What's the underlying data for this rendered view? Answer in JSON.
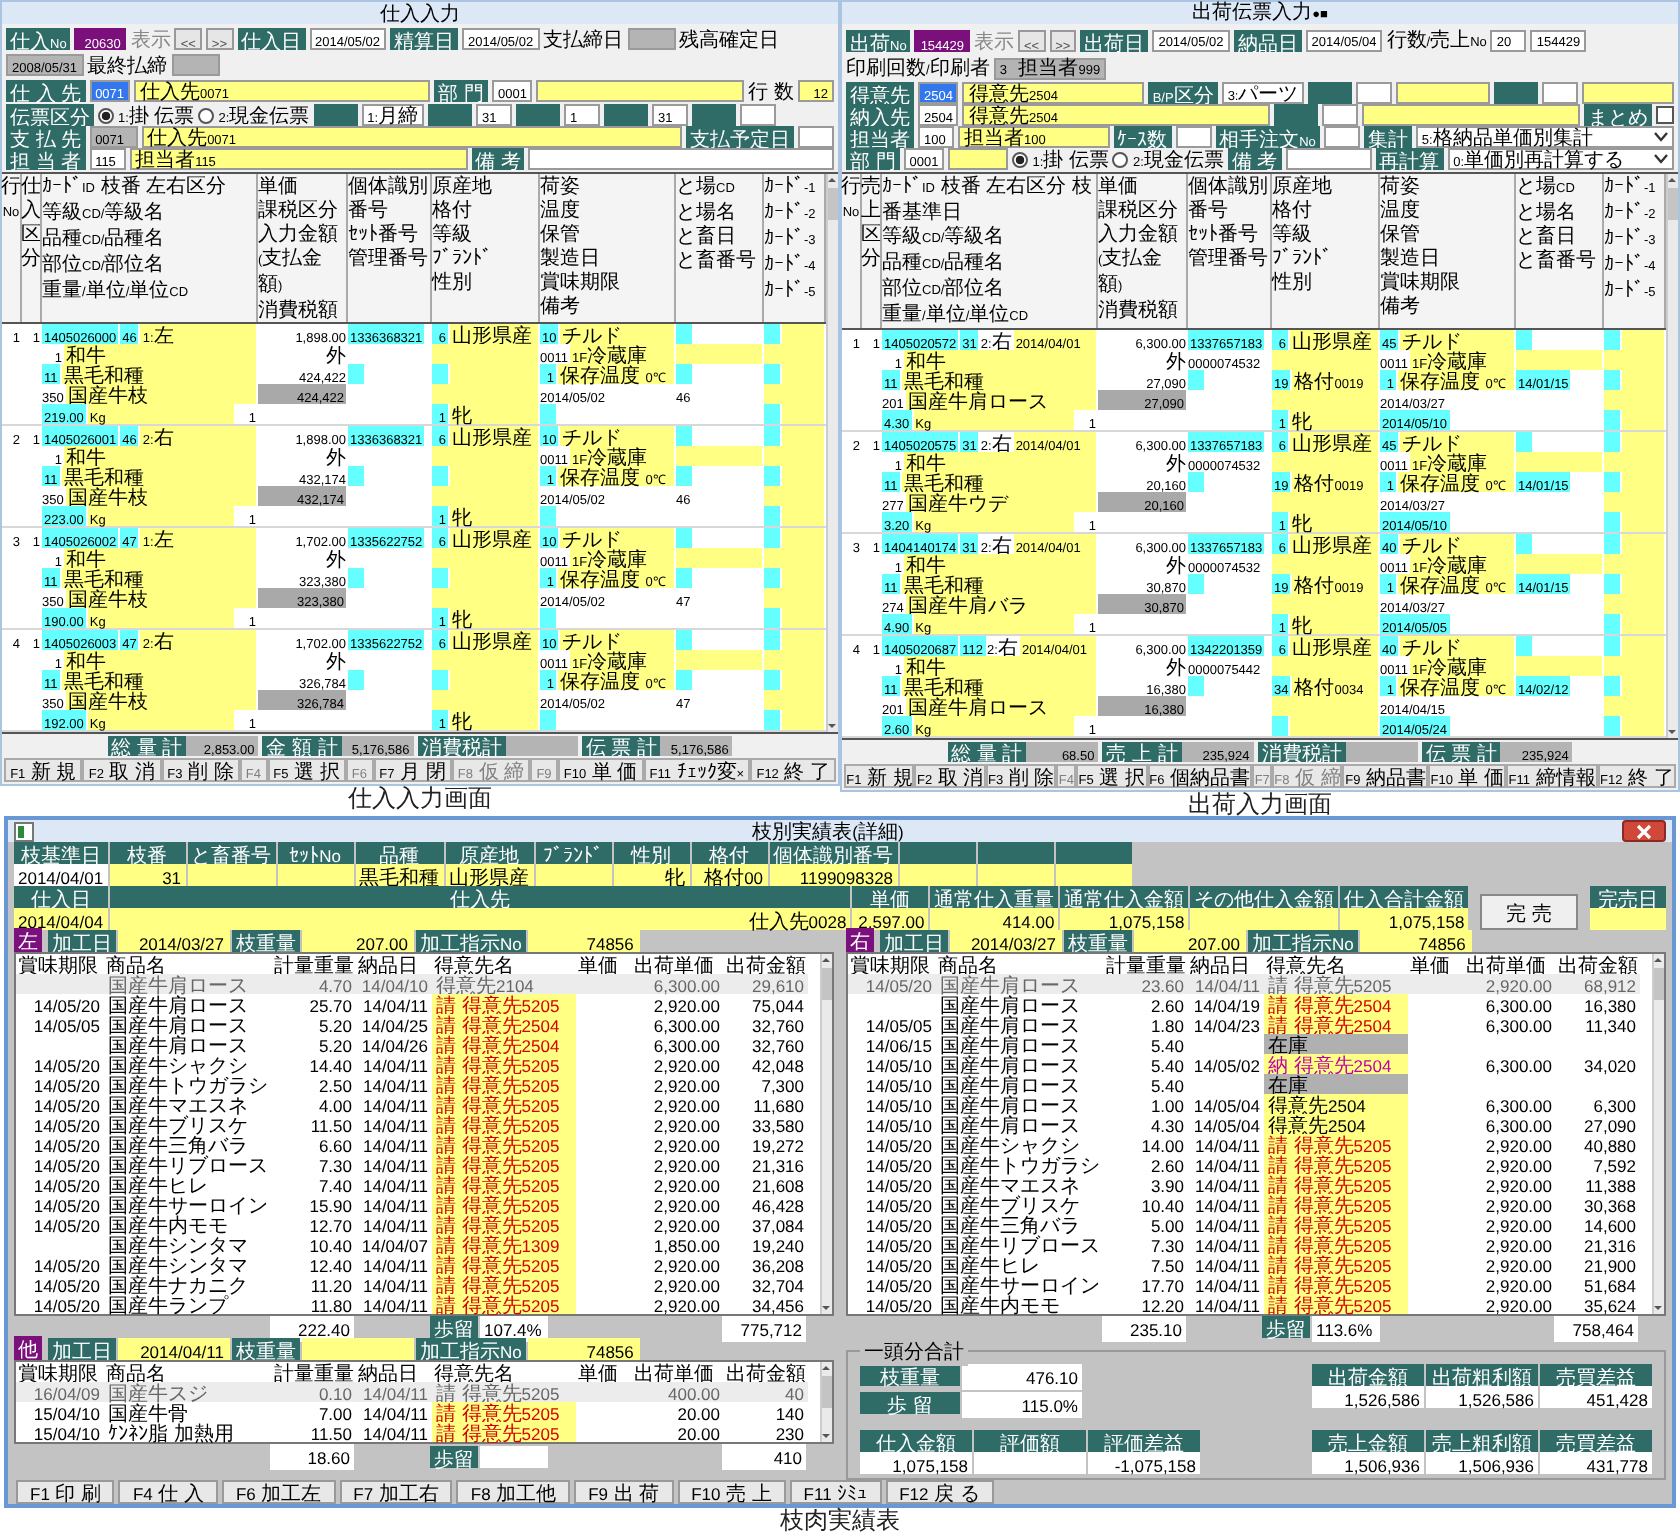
{
  "entry_windows": [
    {
      "kind": "purchase",
      "title": "仕入入力",
      "caption": "仕入入力画面",
      "header_rows": [
        [
          {
            "kind": "label",
            "text": "仕入No"
          },
          {
            "kind": "record",
            "text": "20630"
          },
          {
            "kind": "hint",
            "text": "表示"
          },
          {
            "kind": "button",
            "text": "<<"
          },
          {
            "kind": "button",
            "text": ">>"
          },
          {
            "kind": "label",
            "text": "仕入日"
          },
          {
            "kind": "field",
            "text": "2014/05/02"
          },
          {
            "kind": "label",
            "text": "精算日"
          },
          {
            "kind": "field",
            "text": "2014/05/02"
          },
          {
            "kind": "text",
            "text": "支払締日"
          },
          {
            "kind": "gray"
          },
          {
            "kind": "text",
            "text": "残高確定日"
          },
          {
            "kind": "gray",
            "text": "2008/05/31"
          },
          {
            "kind": "text",
            "text": "最終払締"
          },
          {
            "kind": "gray"
          }
        ],
        [
          {
            "kind": "label",
            "text": "仕 入 先"
          },
          {
            "kind": "selected",
            "text": "0071"
          },
          {
            "kind": "name",
            "text": "仕入先0071"
          },
          {
            "kind": "label",
            "text": "部 門"
          },
          {
            "kind": "field",
            "text": "0001"
          },
          {
            "kind": "name"
          },
          {
            "kind": "text",
            "text": "行 数"
          },
          {
            "kind": "number",
            "text": "12"
          }
        ],
        [
          {
            "kind": "label",
            "text": "伝票区分"
          },
          {
            "kind": "radio",
            "text": "1:掛 伝票",
            "selected": true
          },
          {
            "kind": "radio",
            "text": "2:現金伝票",
            "selected": false
          },
          {
            "kind": "label"
          },
          {
            "kind": "field",
            "text": "1:月締"
          },
          {
            "kind": "label"
          },
          {
            "kind": "field",
            "text": "31"
          },
          {
            "kind": "label"
          },
          {
            "kind": "field",
            "text": "1"
          },
          {
            "kind": "label"
          },
          {
            "kind": "field",
            "text": "31"
          },
          {
            "kind": "label"
          },
          {
            "kind": "field"
          }
        ],
        [
          {
            "kind": "label",
            "text": "支 払 先"
          },
          {
            "kind": "gray",
            "text": "0071"
          },
          {
            "kind": "name",
            "text": "仕入先0071"
          },
          {
            "kind": "label",
            "text": "支払予定日"
          },
          {
            "kind": "field"
          }
        ],
        [
          {
            "kind": "label",
            "text": "担 当 者"
          },
          {
            "kind": "field",
            "text": "115"
          },
          {
            "kind": "name",
            "text": "担当者115"
          },
          {
            "kind": "label",
            "text": "備 考"
          },
          {
            "kind": "memo"
          }
        ]
      ],
      "columns": [
        [
          "行",
          "No"
        ],
        [
          "仕入区分"
        ],
        [
          "ｶｰﾄﾞID 枝番 左右区分",
          "等級CD/等級名",
          "品種CD/品種名",
          "部位CD/部位名",
          "重量/単位/単位CD"
        ],
        [
          "単価",
          "課税区分",
          "入力金額",
          "(支払金額)",
          "消費税額"
        ],
        [
          "個体識別番号",
          "ｾｯﾄ番号",
          "管理番号"
        ],
        [
          "原産地",
          "格付",
          "等級",
          "ﾌﾞﾗﾝﾄﾞ",
          "性別"
        ],
        [
          "荷姿",
          "温度",
          "保管",
          "製造日",
          "賞味期限",
          "備考"
        ],
        [
          "と場CD",
          "と場名",
          "と畜日",
          "と畜番号"
        ],
        [
          "ｶｰﾄﾞ-1",
          "ｶｰﾄﾞ-2",
          "ｶｰﾄﾞ-3",
          "ｶｰﾄﾞ-4",
          "ｶｰﾄﾞ-5"
        ]
      ],
      "records": [
        {
          "no": "1",
          "type": "1",
          "card_id": "1405026000",
          "branch": "46",
          "side": "1:左",
          "grade_cd": "1",
          "grade": "和牛",
          "breed_cd": "11",
          "breed": "黒毛和種",
          "part_cd": "350",
          "part": "国産牛枝",
          "weight": "219.00",
          "unit": "Kg",
          "unit_cd": "1",
          "price": "1,898.00",
          "tax": "外",
          "amount": "424,422",
          "pay_amount": "424,422",
          "indiv_no": "1336368321",
          "origin_cd": "6",
          "origin": "山形県産",
          "sex_cd": "1",
          "sex": "牝",
          "pack_cd": "10",
          "pack": "チルド",
          "storage_cd": "0011",
          "storage": "1F冷蔵庫",
          "temp_cd": "1",
          "temp": "保存温度 0℃",
          "made": "2014/05/02",
          "slaughter_no": "46"
        },
        {
          "no": "2",
          "type": "1",
          "card_id": "1405026001",
          "branch": "46",
          "side": "2:右",
          "grade_cd": "1",
          "grade": "和牛",
          "breed_cd": "11",
          "breed": "黒毛和種",
          "part_cd": "350",
          "part": "国産牛枝",
          "weight": "223.00",
          "unit": "Kg",
          "unit_cd": "1",
          "price": "1,898.00",
          "tax": "外",
          "amount": "432,174",
          "pay_amount": "432,174",
          "indiv_no": "1336368321",
          "origin_cd": "6",
          "origin": "山形県産",
          "sex_cd": "1",
          "sex": "牝",
          "pack_cd": "10",
          "pack": "チルド",
          "storage_cd": "0011",
          "storage": "1F冷蔵庫",
          "temp_cd": "1",
          "temp": "保存温度 0℃",
          "made": "2014/05/02",
          "slaughter_no": "46"
        },
        {
          "no": "3",
          "type": "1",
          "card_id": "1405026002",
          "branch": "47",
          "side": "1:左",
          "grade_cd": "1",
          "grade": "和牛",
          "breed_cd": "11",
          "breed": "黒毛和種",
          "part_cd": "350",
          "part": "国産牛枝",
          "weight": "190.00",
          "unit": "Kg",
          "unit_cd": "1",
          "price": "1,702.00",
          "tax": "外",
          "amount": "323,380",
          "pay_amount": "323,380",
          "indiv_no": "1335622752",
          "origin_cd": "6",
          "origin": "山形県産",
          "sex_cd": "1",
          "sex": "牝",
          "pack_cd": "10",
          "pack": "チルド",
          "storage_cd": "0011",
          "storage": "1F冷蔵庫",
          "temp_cd": "1",
          "temp": "保存温度 0℃",
          "made": "2014/05/02",
          "slaughter_no": "47"
        },
        {
          "no": "4",
          "type": "1",
          "card_id": "1405026003",
          "branch": "47",
          "side": "2:右",
          "grade_cd": "1",
          "grade": "和牛",
          "breed_cd": "11",
          "breed": "黒毛和種",
          "part_cd": "350",
          "part": "国産牛枝",
          "weight": "192.00",
          "unit": "Kg",
          "unit_cd": "1",
          "price": "1,702.00",
          "tax": "外",
          "amount": "326,784",
          "pay_amount": "326,784",
          "indiv_no": "1335622752",
          "origin_cd": "6",
          "origin": "山形県産",
          "sex_cd": "1",
          "sex": "牝",
          "pack_cd": "10",
          "pack": "チルド",
          "storage_cd": "0011",
          "storage": "1F冷蔵庫",
          "temp_cd": "1",
          "temp": "保存温度 0℃",
          "made": "2014/05/02",
          "slaughter_no": "47"
        }
      ],
      "totals": [
        {
          "label": "総 量 計",
          "value": "2,853.00"
        },
        {
          "label": "金 額 計",
          "value": "5,176,586"
        },
        {
          "label": "消費税計"
        },
        {
          "label": "伝 票 計",
          "value": "5,176,586"
        }
      ],
      "function_keys": [
        {
          "text": "F1 新 規",
          "disabled": false
        },
        {
          "text": "F2 取 消",
          "disabled": false
        },
        {
          "text": "F3 削 除",
          "disabled": false
        },
        {
          "text": "F4",
          "disabled": true
        },
        {
          "text": "F5 選 択",
          "disabled": false
        },
        {
          "text": "F6",
          "disabled": true
        },
        {
          "text": "F7 月 閉",
          "disabled": false
        },
        {
          "text": "F8 仮 締",
          "disabled": true
        },
        {
          "text": "F9",
          "disabled": true
        },
        {
          "text": "F10 単 価",
          "disabled": false
        },
        {
          "text": "F11 ﾁｪｯｸ変×",
          "disabled": false
        },
        {
          "text": "F12 終 了",
          "disabled": false
        }
      ]
    },
    {
      "kind": "shipment",
      "title": "出荷伝票入力●■",
      "caption": "出荷入力画面",
      "header_rows": [
        [
          {
            "kind": "label",
            "text": "出荷No"
          },
          {
            "kind": "record",
            "text": "154429"
          },
          {
            "kind": "hint",
            "text": "表示"
          },
          {
            "kind": "button",
            "text": "<<"
          },
          {
            "kind": "button",
            "text": ">>"
          },
          {
            "kind": "label",
            "text": "出荷日"
          },
          {
            "kind": "field",
            "text": "2014/05/02"
          },
          {
            "kind": "label",
            "text": "納品日"
          },
          {
            "kind": "field",
            "text": "2014/05/04"
          },
          {
            "kind": "text",
            "text": "行数/売上No"
          },
          {
            "kind": "field",
            "text": "20"
          },
          {
            "kind": "field",
            "text": "154429"
          },
          {
            "kind": "text",
            "text": "印刷回数/印刷者"
          },
          {
            "kind": "gray",
            "text": "3 担当者999"
          }
        ],
        [
          {
            "kind": "label",
            "text": "得意先"
          },
          {
            "kind": "selected",
            "text": "2504"
          },
          {
            "kind": "name",
            "text": "得意先2504"
          },
          {
            "kind": "label",
            "text": "B/P区分"
          },
          {
            "kind": "field",
            "text": "3:パーツ"
          },
          {
            "kind": "label"
          },
          {
            "kind": "field"
          },
          {
            "kind": "name"
          },
          {
            "kind": "label"
          },
          {
            "kind": "field"
          },
          {
            "kind": "name"
          }
        ],
        [
          {
            "kind": "label",
            "text": "納入先"
          },
          {
            "kind": "field",
            "text": "2504"
          },
          {
            "kind": "name",
            "text": "得意先2504"
          },
          {
            "kind": "label"
          },
          {
            "kind": "field"
          },
          {
            "kind": "name"
          },
          {
            "kind": "label",
            "text": "まとめ"
          },
          {
            "kind": "checkbox",
            "checked": false
          }
        ],
        [
          {
            "kind": "label",
            "text": "担当者"
          },
          {
            "kind": "field",
            "text": "100"
          },
          {
            "kind": "name",
            "text": "担当者100"
          },
          {
            "kind": "label",
            "text": "ｹｰｽ数"
          },
          {
            "kind": "field"
          },
          {
            "kind": "label",
            "text": "相手注文No"
          },
          {
            "kind": "field"
          },
          {
            "kind": "label",
            "text": "集計"
          },
          {
            "kind": "select",
            "text": "5:格納品単価別集計"
          }
        ],
        [
          {
            "kind": "label",
            "text": "部 門"
          },
          {
            "kind": "field",
            "text": "0001"
          },
          {
            "kind": "name"
          },
          {
            "kind": "radio",
            "text": "1:掛 伝票",
            "selected": true
          },
          {
            "kind": "radio",
            "text": "2:現金伝票",
            "selected": false
          },
          {
            "kind": "label",
            "text": "備 考"
          },
          {
            "kind": "memo"
          },
          {
            "kind": "label",
            "text": "再計算"
          },
          {
            "kind": "select",
            "text": "0:単価別再計算する"
          }
        ]
      ],
      "columns": [
        [
          "行",
          "No"
        ],
        [
          "売上区分"
        ],
        [
          "ｶｰﾄﾞID 枝番 左右区分 枝番基準日",
          "等級CD/等級名",
          "品種CD/品種名",
          "部位CD/部位名",
          "重量/単位/単位CD"
        ],
        [
          "単価",
          "課税区分",
          "入力金額",
          "(支払金額)",
          "消費税額"
        ],
        [
          "個体識別番号",
          "ｾｯﾄ番号",
          "管理番号"
        ],
        [
          "原産地",
          "格付",
          "等級",
          "ﾌﾞﾗﾝﾄﾞ",
          "性別"
        ],
        [
          "荷姿",
          "温度",
          "保管",
          "製造日",
          "賞味期限",
          "備考"
        ],
        [
          "と場CD",
          "と場名",
          "と畜日",
          "と畜番号"
        ],
        [
          "ｶｰﾄﾞ-1",
          "ｶｰﾄﾞ-2",
          "ｶｰﾄﾞ-3",
          "ｶｰﾄﾞ-4",
          "ｶｰﾄﾞ-5"
        ]
      ],
      "records": [
        {
          "no": "1",
          "type": "1",
          "card_id": "1405020572",
          "branch": "31",
          "side": "2:右",
          "base_date": "2014/04/01",
          "grade_cd": "1",
          "grade": "和牛",
          "breed_cd": "11",
          "breed": "黒毛和種",
          "part_cd": "201",
          "part": "国産牛肩ロース",
          "weight": "4.30",
          "unit": "Kg",
          "unit_cd": "1",
          "price": "6,300.00",
          "tax": "外",
          "amount": "27,090",
          "pay_amount": "27,090",
          "indiv_no": "1337657183",
          "set_no": "0000074532",
          "origin_cd": "6",
          "origin": "山形県産",
          "grade2_cd": "19",
          "grade2": "格付0019",
          "sex_cd": "1",
          "sex": "牝",
          "pack_cd": "45",
          "pack": "チルド",
          "storage_cd": "0011",
          "storage": "1F冷蔵庫",
          "temp_cd": "1",
          "temp": "保存温度 0℃",
          "best": "14/01/15",
          "made": "2014/03/27",
          "expiry": "2014/05/10"
        },
        {
          "no": "2",
          "type": "1",
          "card_id": "1405020575",
          "branch": "31",
          "side": "2:右",
          "base_date": "2014/04/01",
          "grade_cd": "1",
          "grade": "和牛",
          "breed_cd": "11",
          "breed": "黒毛和種",
          "part_cd": "277",
          "part": "国産牛ウデ",
          "weight": "3.20",
          "unit": "Kg",
          "unit_cd": "1",
          "price": "6,300.00",
          "tax": "外",
          "amount": "20,160",
          "pay_amount": "20,160",
          "indiv_no": "1337657183",
          "set_no": "0000074532",
          "origin_cd": "6",
          "origin": "山形県産",
          "grade2_cd": "19",
          "grade2": "格付0019",
          "sex_cd": "1",
          "sex": "牝",
          "pack_cd": "45",
          "pack": "チルド",
          "storage_cd": "0011",
          "storage": "1F冷蔵庫",
          "temp_cd": "1",
          "temp": "保存温度 0℃",
          "best": "14/01/15",
          "made": "2014/03/27",
          "expiry": "2014/05/10"
        },
        {
          "no": "3",
          "type": "1",
          "card_id": "1404140174",
          "branch": "31",
          "side": "2:右",
          "base_date": "2014/04/01",
          "grade_cd": "1",
          "grade": "和牛",
          "breed_cd": "11",
          "breed": "黒毛和種",
          "part_cd": "274",
          "part": "国産牛肩バラ",
          "weight": "4.90",
          "unit": "Kg",
          "unit_cd": "1",
          "price": "6,300.00",
          "tax": "外",
          "amount": "30,870",
          "pay_amount": "30,870",
          "indiv_no": "1337657183",
          "set_no": "0000074532",
          "origin_cd": "6",
          "origin": "山形県産",
          "grade2_cd": "19",
          "grade2": "格付0019",
          "sex_cd": "1",
          "sex": "牝",
          "pack_cd": "40",
          "pack": "チルド",
          "storage_cd": "0011",
          "storage": "1F冷蔵庫",
          "temp_cd": "1",
          "temp": "保存温度 0℃",
          "best": "14/01/15",
          "made": "2014/03/27",
          "expiry": "2014/05/05"
        },
        {
          "no": "4",
          "type": "1",
          "card_id": "1405020687",
          "branch": "112",
          "side": "2:右",
          "base_date": "2014/04/01",
          "grade_cd": "1",
          "grade": "和牛",
          "breed_cd": "11",
          "breed": "黒毛和種",
          "part_cd": "201",
          "part": "国産牛肩ロース",
          "weight": "2.60",
          "unit": "Kg",
          "unit_cd": "1",
          "price": "6,300.00",
          "tax": "外",
          "amount": "16,380",
          "pay_amount": "16,380",
          "indiv_no": "1342201359",
          "set_no": "0000075442",
          "origin_cd": "6",
          "origin": "山形県産",
          "grade2_cd": "34",
          "grade2": "格付0034",
          "pack_cd": "40",
          "pack": "チルド",
          "storage_cd": "0011",
          "storage": "1F冷蔵庫",
          "temp_cd": "1",
          "temp": "保存温度 0℃",
          "best": "14/02/12",
          "made": "2014/04/15",
          "expiry": "2014/05/24"
        }
      ],
      "totals": [
        {
          "label": "総 量 計",
          "value": "68.50"
        },
        {
          "label": "売 上 計",
          "value": "235,924"
        },
        {
          "label": "消費税計"
        },
        {
          "label": "伝 票 計",
          "value": "235,924"
        }
      ],
      "function_keys": [
        {
          "text": "F1 新 規",
          "disabled": false
        },
        {
          "text": "F2 取 消",
          "disabled": false
        },
        {
          "text": "F3 削 除",
          "disabled": false
        },
        {
          "text": "F4",
          "disabled": true
        },
        {
          "text": "F5 選 択",
          "disabled": false
        },
        {
          "text": "F6 個納品書",
          "disabled": false
        },
        {
          "text": "F7",
          "disabled": true
        },
        {
          "text": "F8 仮 締",
          "disabled": true
        },
        {
          "text": "F9 納品書",
          "disabled": false
        },
        {
          "text": "F10 単 価",
          "disabled": false
        },
        {
          "text": "F11 締情報",
          "disabled": false
        },
        {
          "text": "F12 終 了",
          "disabled": false
        }
      ]
    }
  ],
  "report_window": {
    "title": "枝別実績表(詳細)",
    "caption": "枝肉実績表",
    "info_rows": [
      [
        {
          "header": "枝基準日",
          "value": "2014/04/01",
          "kind": "key"
        },
        {
          "header": "枝番",
          "value": "31",
          "kind": "value"
        },
        {
          "header": "と畜番号",
          "kind": "value"
        },
        {
          "header": "ｾｯﾄNo",
          "kind": "value"
        },
        {
          "header": "品種",
          "value": "黒毛和種",
          "kind": "value"
        },
        {
          "header": "原産地",
          "value": "山形県産",
          "kind": "value"
        },
        {
          "header": "ﾌﾞﾗﾝﾄﾞ",
          "kind": "value"
        },
        {
          "header": "性別",
          "value": "牝",
          "kind": "value"
        },
        {
          "header": "格付",
          "value": "格付00",
          "kind": "value"
        },
        {
          "header": "個体識別番号",
          "value": "1199098328",
          "kind": "value"
        },
        {
          "kind": "blank"
        },
        {
          "kind": "blank"
        },
        {
          "kind": "blank"
        }
      ],
      [
        {
          "header": "仕入日",
          "value": "2014/04/04",
          "kind": "value"
        },
        {
          "header": "仕入先",
          "value": "仕入先0028",
          "kind": "wide"
        },
        {
          "header": "単価",
          "value": "2,597.00",
          "kind": "value"
        },
        {
          "header": "通常仕入重量",
          "value": "414.00",
          "kind": "value"
        },
        {
          "header": "通常仕入金額",
          "value": "1,075,158",
          "kind": "value"
        },
        {
          "header": "その他仕入金額",
          "kind": "value"
        },
        {
          "header": "仕入合計金額",
          "value": "1,075,158",
          "kind": "value"
        }
      ]
    ],
    "complete_button": "完 売",
    "complete_date_label": "完売日",
    "sections": [
      {
        "badge": "左",
        "fields": [
          {
            "label": "加工日",
            "value": "2014/03/27"
          },
          {
            "label": "枝重量",
            "value": "207.00"
          },
          {
            "label": "加工指示No",
            "value": "74856"
          }
        ],
        "columns": [
          "賞味期限",
          "商品名",
          "計量重量",
          "納品日",
          "得意先名",
          "単価",
          "出荷単価",
          "出荷金額"
        ],
        "rows": [
          {
            "product": "国産牛肩ロース",
            "weight": "4.70",
            "delivery_date": "14/04/10",
            "customer": "得意先2104",
            "kind": "plain",
            "price": "6,300.00",
            "amount": "29,610",
            "dim": true
          },
          {
            "expiry": "14/05/20",
            "product": "国産牛肩ロース",
            "weight": "25.70",
            "delivery_date": "14/04/11",
            "customer": "請 得意先5205",
            "kind": "request",
            "price": "2,920.00",
            "amount": "75,044",
            "dim": false
          },
          {
            "expiry": "14/05/05",
            "product": "国産牛肩ロース",
            "weight": "5.20",
            "delivery_date": "14/04/25",
            "customer": "請 得意先2504",
            "kind": "request",
            "price": "6,300.00",
            "amount": "32,760",
            "dim": false
          },
          {
            "product": "国産牛肩ロース",
            "weight": "5.20",
            "delivery_date": "14/04/26",
            "customer": "請 得意先2504",
            "kind": "request",
            "price": "6,300.00",
            "amount": "32,760",
            "dim": false
          },
          {
            "expiry": "14/05/20",
            "product": "国産牛シャクシ",
            "weight": "14.40",
            "delivery_date": "14/04/11",
            "customer": "請 得意先5205",
            "kind": "request",
            "price": "2,920.00",
            "amount": "42,048",
            "dim": false
          },
          {
            "expiry": "14/05/20",
            "product": "国産牛トウガラシ",
            "weight": "2.50",
            "delivery_date": "14/04/11",
            "customer": "請 得意先5205",
            "kind": "request",
            "price": "2,920.00",
            "amount": "7,300",
            "dim": false
          },
          {
            "expiry": "14/05/20",
            "product": "国産牛マエスネ",
            "weight": "4.00",
            "delivery_date": "14/04/11",
            "customer": "請 得意先5205",
            "kind": "request",
            "price": "2,920.00",
            "amount": "11,680",
            "dim": false
          },
          {
            "expiry": "14/05/20",
            "product": "国産牛ブリスケ",
            "weight": "11.50",
            "delivery_date": "14/04/11",
            "customer": "請 得意先5205",
            "kind": "request",
            "price": "2,920.00",
            "amount": "33,580",
            "dim": false
          },
          {
            "expiry": "14/05/20",
            "product": "国産牛三角バラ",
            "weight": "6.60",
            "delivery_date": "14/04/11",
            "customer": "請 得意先5205",
            "kind": "request",
            "price": "2,920.00",
            "amount": "19,272",
            "dim": false
          },
          {
            "expiry": "14/05/20",
            "product": "国産牛リブロース",
            "weight": "7.30",
            "delivery_date": "14/04/11",
            "customer": "請 得意先5205",
            "kind": "request",
            "price": "2,920.00",
            "amount": "21,316",
            "dim": false
          },
          {
            "expiry": "14/05/20",
            "product": "国産牛ヒレ",
            "weight": "7.40",
            "delivery_date": "14/04/11",
            "customer": "請 得意先5205",
            "kind": "request",
            "price": "2,920.00",
            "amount": "21,608",
            "dim": false
          },
          {
            "expiry": "14/05/20",
            "product": "国産牛サーロイン",
            "weight": "15.90",
            "delivery_date": "14/04/11",
            "customer": "請 得意先5205",
            "kind": "request",
            "price": "2,920.00",
            "amount": "46,428",
            "dim": false
          },
          {
            "expiry": "14/05/20",
            "product": "国産牛内モモ",
            "weight": "12.70",
            "delivery_date": "14/04/11",
            "customer": "請 得意先5205",
            "kind": "request",
            "price": "2,920.00",
            "amount": "37,084",
            "dim": false
          },
          {
            "product": "国産牛シンタマ",
            "weight": "10.40",
            "delivery_date": "14/04/07",
            "customer": "請 得意先1309",
            "kind": "request",
            "price": "1,850.00",
            "amount": "19,240",
            "dim": false
          },
          {
            "expiry": "14/05/20",
            "product": "国産牛シンタマ",
            "weight": "12.40",
            "delivery_date": "14/04/11",
            "customer": "請 得意先5205",
            "kind": "request",
            "price": "2,920.00",
            "amount": "36,208",
            "dim": false
          },
          {
            "expiry": "14/05/20",
            "product": "国産牛ナカニク",
            "weight": "11.20",
            "delivery_date": "14/04/11",
            "customer": "請 得意先5205",
            "kind": "request",
            "price": "2,920.00",
            "amount": "32,704",
            "dim": false
          },
          {
            "expiry": "14/05/20",
            "product": "国産牛ランプ",
            "weight": "11.80",
            "delivery_date": "14/04/11",
            "customer": "請 得意先5205",
            "kind": "request",
            "price": "2,920.00",
            "amount": "34,456",
            "dim": false
          }
        ],
        "totals": {
          "weight": "222.40",
          "yield_label": "歩留",
          "yield": "107.4%",
          "amount": "775,712"
        }
      },
      {
        "badge": "右",
        "fields": [
          {
            "label": "加工日",
            "value": "2014/03/27"
          },
          {
            "label": "枝重量",
            "value": "207.00"
          },
          {
            "label": "加工指示No",
            "value": "74856"
          }
        ],
        "columns": [
          "賞味期限",
          "商品名",
          "計量重量",
          "納品日",
          "得意先名",
          "単価",
          "出荷単価",
          "出荷金額"
        ],
        "rows": [
          {
            "expiry": "14/05/20",
            "product": "国産牛肩ロース",
            "weight": "23.60",
            "delivery_date": "14/04/11",
            "customer": "請 得意先5205",
            "kind": "plain",
            "price": "2,920.00",
            "amount": "68,912",
            "dim": true
          },
          {
            "product": "国産牛肩ロース",
            "weight": "2.60",
            "delivery_date": "14/04/19",
            "customer": "請 得意先2504",
            "kind": "request",
            "price": "6,300.00",
            "amount": "16,380",
            "dim": false
          },
          {
            "expiry": "14/05/05",
            "product": "国産牛肩ロース",
            "weight": "1.80",
            "delivery_date": "14/04/23",
            "customer": "請 得意先2504",
            "kind": "request",
            "price": "6,300.00",
            "amount": "11,340",
            "dim": false
          },
          {
            "expiry": "14/06/15",
            "product": "国産牛肩ロース",
            "weight": "5.40",
            "customer": "在庫",
            "kind": "stock",
            "dim": false
          },
          {
            "expiry": "14/05/10",
            "product": "国産牛肩ロース",
            "weight": "5.40",
            "delivery_date": "14/05/02",
            "customer": "納 得意先2504",
            "kind": "delivery",
            "price": "6,300.00",
            "amount": "34,020",
            "dim": false
          },
          {
            "expiry": "14/05/10",
            "product": "国産牛肩ロース",
            "weight": "5.40",
            "customer": "在庫",
            "kind": "stock",
            "dim": false
          },
          {
            "expiry": "14/05/10",
            "product": "国産牛肩ロース",
            "weight": "1.00",
            "delivery_date": "14/05/04",
            "customer": "得意先2504",
            "kind": "confirmed",
            "price": "6,300.00",
            "amount": "6,300",
            "dim": false
          },
          {
            "expiry": "14/05/10",
            "product": "国産牛肩ロース",
            "weight": "4.30",
            "delivery_date": "14/05/04",
            "customer": "得意先2504",
            "kind": "confirmed",
            "price": "6,300.00",
            "amount": "27,090",
            "dim": false
          },
          {
            "expiry": "14/05/20",
            "product": "国産牛シャクシ",
            "weight": "14.00",
            "delivery_date": "14/04/11",
            "customer": "請 得意先5205",
            "kind": "request",
            "price": "2,920.00",
            "amount": "40,880",
            "dim": false
          },
          {
            "expiry": "14/05/20",
            "product": "国産牛トウガラシ",
            "weight": "2.60",
            "delivery_date": "14/04/11",
            "customer": "請 得意先5205",
            "kind": "request",
            "price": "2,920.00",
            "amount": "7,592",
            "dim": false
          },
          {
            "expiry": "14/05/20",
            "product": "国産牛マエスネ",
            "weight": "3.90",
            "delivery_date": "14/04/11",
            "customer": "請 得意先5205",
            "kind": "request",
            "price": "2,920.00",
            "amount": "11,388",
            "dim": false
          },
          {
            "expiry": "14/05/20",
            "product": "国産牛ブリスケ",
            "weight": "10.40",
            "delivery_date": "14/04/11",
            "customer": "請 得意先5205",
            "kind": "request",
            "price": "2,920.00",
            "amount": "30,368",
            "dim": false
          },
          {
            "expiry": "14/05/20",
            "product": "国産牛三角バラ",
            "weight": "5.00",
            "delivery_date": "14/04/11",
            "customer": "請 得意先5205",
            "kind": "request",
            "price": "2,920.00",
            "amount": "14,600",
            "dim": false
          },
          {
            "expiry": "14/05/20",
            "product": "国産牛リブロース",
            "weight": "7.30",
            "delivery_date": "14/04/11",
            "customer": "請 得意先5205",
            "kind": "request",
            "price": "2,920.00",
            "amount": "21,316",
            "dim": false
          },
          {
            "expiry": "14/05/20",
            "product": "国産牛ヒレ",
            "weight": "7.50",
            "delivery_date": "14/04/11",
            "customer": "請 得意先5205",
            "kind": "request",
            "price": "2,920.00",
            "amount": "21,900",
            "dim": false
          },
          {
            "expiry": "14/05/20",
            "product": "国産牛サーロイン",
            "weight": "17.70",
            "delivery_date": "14/04/11",
            "customer": "請 得意先5205",
            "kind": "request",
            "price": "2,920.00",
            "amount": "51,684",
            "dim": false
          },
          {
            "expiry": "14/05/20",
            "product": "国産牛内モモ",
            "weight": "12.20",
            "delivery_date": "14/04/11",
            "customer": "請 得意先5205",
            "kind": "request",
            "price": "2,920.00",
            "amount": "35,624",
            "dim": false
          }
        ],
        "totals": {
          "weight": "235.10",
          "yield_label": "歩留",
          "yield": "113.6%",
          "amount": "758,464"
        }
      },
      {
        "badge": "他",
        "fields": [
          {
            "label": "加工日",
            "value": "2014/04/11"
          },
          {
            "label": "枝重量"
          },
          {
            "label": "加工指示No",
            "value": "74856"
          }
        ],
        "columns": [
          "賞味期限",
          "商品名",
          "計量重量",
          "納品日",
          "得意先名",
          "単価",
          "出荷単価",
          "出荷金額"
        ],
        "rows": [
          {
            "expiry": "16/04/09",
            "product": "国産牛スジ",
            "weight": "0.10",
            "delivery_date": "14/04/11",
            "customer": "請 得意先5205",
            "kind": "plain",
            "price": "400.00",
            "amount": "40",
            "dim": true
          },
          {
            "expiry": "15/04/10",
            "product": "国産牛骨",
            "weight": "7.00",
            "delivery_date": "14/04/11",
            "customer": "請 得意先5205",
            "kind": "request",
            "price": "20.00",
            "amount": "140",
            "dim": false
          },
          {
            "expiry": "15/04/10",
            "product": "ｹﾝﾈﾝ脂 加熱用",
            "weight": "11.50",
            "delivery_date": "14/04/11",
            "customer": "請 得意先5205",
            "kind": "request",
            "price": "20.00",
            "amount": "230",
            "dim": false
          }
        ],
        "totals": {
          "weight": "18.60",
          "yield_label": "歩留",
          "amount": "410"
        }
      }
    ],
    "summary": {
      "title": "一頭分合計",
      "stats": [
        {
          "label": "枝重量",
          "value": "476.10"
        },
        {
          "label": "歩 留",
          "value": "115.0%"
        }
      ],
      "tables": [
        [
          {
            "label": "出荷金額",
            "value": "1,526,586"
          },
          {
            "label": "出荷粗利額",
            "value": "1,526,586"
          },
          {
            "label": "売買差益",
            "value": "451,428"
          }
        ],
        [
          {
            "label": "仕入金額",
            "value": "1,075,158"
          },
          {
            "label": "評価額"
          },
          {
            "label": "評価差益",
            "value": "-1,075,158"
          }
        ],
        [
          {
            "label": "売上金額",
            "value": "1,506,936"
          },
          {
            "label": "売上粗利額",
            "value": "1,506,936"
          },
          {
            "label": "売買差益",
            "value": "431,778"
          }
        ]
      ]
    },
    "function_keys": [
      "F1 印 刷",
      "F4 仕 入",
      "F6 加工左",
      "F7 加工右",
      "F8 加工他",
      "F9 出 荷",
      "F10 売 上",
      "F11 ｼﾐｭ",
      "F12 戻 る"
    ]
  }
}
